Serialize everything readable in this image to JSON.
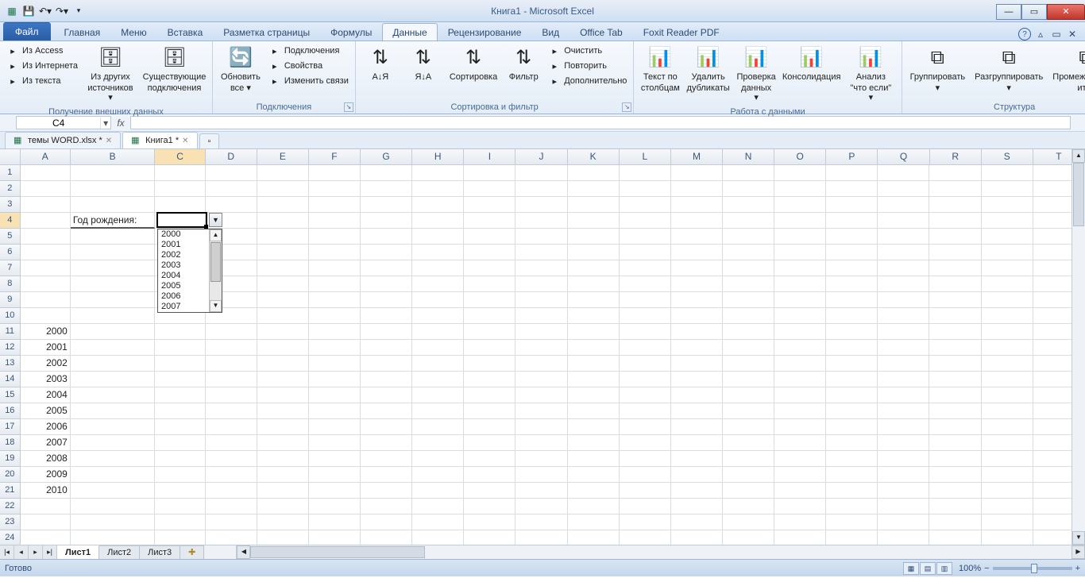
{
  "title": "Книга1  -  Microsoft Excel",
  "qat_icons": [
    "excel-icon",
    "save-icon",
    "undo-icon",
    "redo-icon"
  ],
  "window_buttons": {
    "min": "—",
    "max": "▭",
    "close": "✕"
  },
  "ribbon_help_icons": [
    "help-icon",
    "minimize-ribbon-icon",
    "restore-window-icon",
    "close-window-icon"
  ],
  "tabs": {
    "file": "Файл",
    "list": [
      "Главная",
      "Меню",
      "Вставка",
      "Разметка страницы",
      "Формулы",
      "Данные",
      "Рецензирование",
      "Вид",
      "Office Tab",
      "Foxit Reader PDF"
    ],
    "active": "Данные"
  },
  "ribbon_groups": [
    {
      "title": "Получение внешних данных",
      "small": [
        "Из Access",
        "Из Интернета",
        "Из текста"
      ],
      "big": [
        {
          "l1": "Из других",
          "l2": "источников ▾"
        },
        {
          "l1": "Существующие",
          "l2": "подключения"
        }
      ]
    },
    {
      "title": "Подключения",
      "big": [
        {
          "l1": "Обновить",
          "l2": "все ▾"
        }
      ],
      "small": [
        "Подключения",
        "Свойства",
        "Изменить связи"
      ]
    },
    {
      "title": "Сортировка и фильтр",
      "big": [
        {
          "l1": "А↓Я",
          "l2": ""
        },
        {
          "l1": "Я↓А",
          "l2": ""
        },
        {
          "l1": "Сортировка",
          "l2": ""
        },
        {
          "l1": "Фильтр",
          "l2": ""
        }
      ],
      "small": [
        "Очистить",
        "Повторить",
        "Дополнительно"
      ]
    },
    {
      "title": "Работа с данными",
      "big": [
        {
          "l1": "Текст по",
          "l2": "столбцам"
        },
        {
          "l1": "Удалить",
          "l2": "дубликаты"
        },
        {
          "l1": "Проверка",
          "l2": "данных ▾"
        },
        {
          "l1": "Консолидация",
          "l2": ""
        },
        {
          "l1": "Анализ",
          "l2": "\"что если\" ▾"
        }
      ]
    },
    {
      "title": "Структура",
      "big": [
        {
          "l1": "Группировать",
          "l2": "▾"
        },
        {
          "l1": "Разгруппировать",
          "l2": "▾"
        },
        {
          "l1": "Промежуточный",
          "l2": "итог"
        }
      ]
    }
  ],
  "namebox": "C4",
  "wbtabs": [
    {
      "label": "темы WORD.xlsx *",
      "active": false
    },
    {
      "label": "Книга1 *",
      "active": true
    }
  ],
  "columns": [
    "A",
    "B",
    "C",
    "D",
    "E",
    "F",
    "G",
    "H",
    "I",
    "J",
    "K",
    "L",
    "M",
    "N",
    "O",
    "P",
    "Q",
    "R",
    "S",
    "T"
  ],
  "col_widths": {
    "A": 64,
    "B": 108,
    "C": 64,
    "default": 66
  },
  "row_count": 24,
  "cells": {
    "B4": "Год рождения:",
    "A11": "2000",
    "A12": "2001",
    "A13": "2002",
    "A14": "2003",
    "A15": "2004",
    "A16": "2005",
    "A17": "2006",
    "A18": "2007",
    "A19": "2008",
    "A20": "2009",
    "A21": "2010"
  },
  "active_cell": "C4",
  "dv_button_after": "C4",
  "dv_dropdown": {
    "visible": true,
    "items": [
      "2000",
      "2001",
      "2002",
      "2003",
      "2004",
      "2005",
      "2006",
      "2007"
    ]
  },
  "sheet_tabs": {
    "list": [
      "Лист1",
      "Лист2",
      "Лист3"
    ],
    "active": "Лист1",
    "nav": [
      "|◂",
      "◂",
      "▸",
      "▸|"
    ]
  },
  "status": "Готово",
  "zoom": "100%",
  "zoom_buttons": {
    "minus": "−",
    "plus": "+"
  }
}
